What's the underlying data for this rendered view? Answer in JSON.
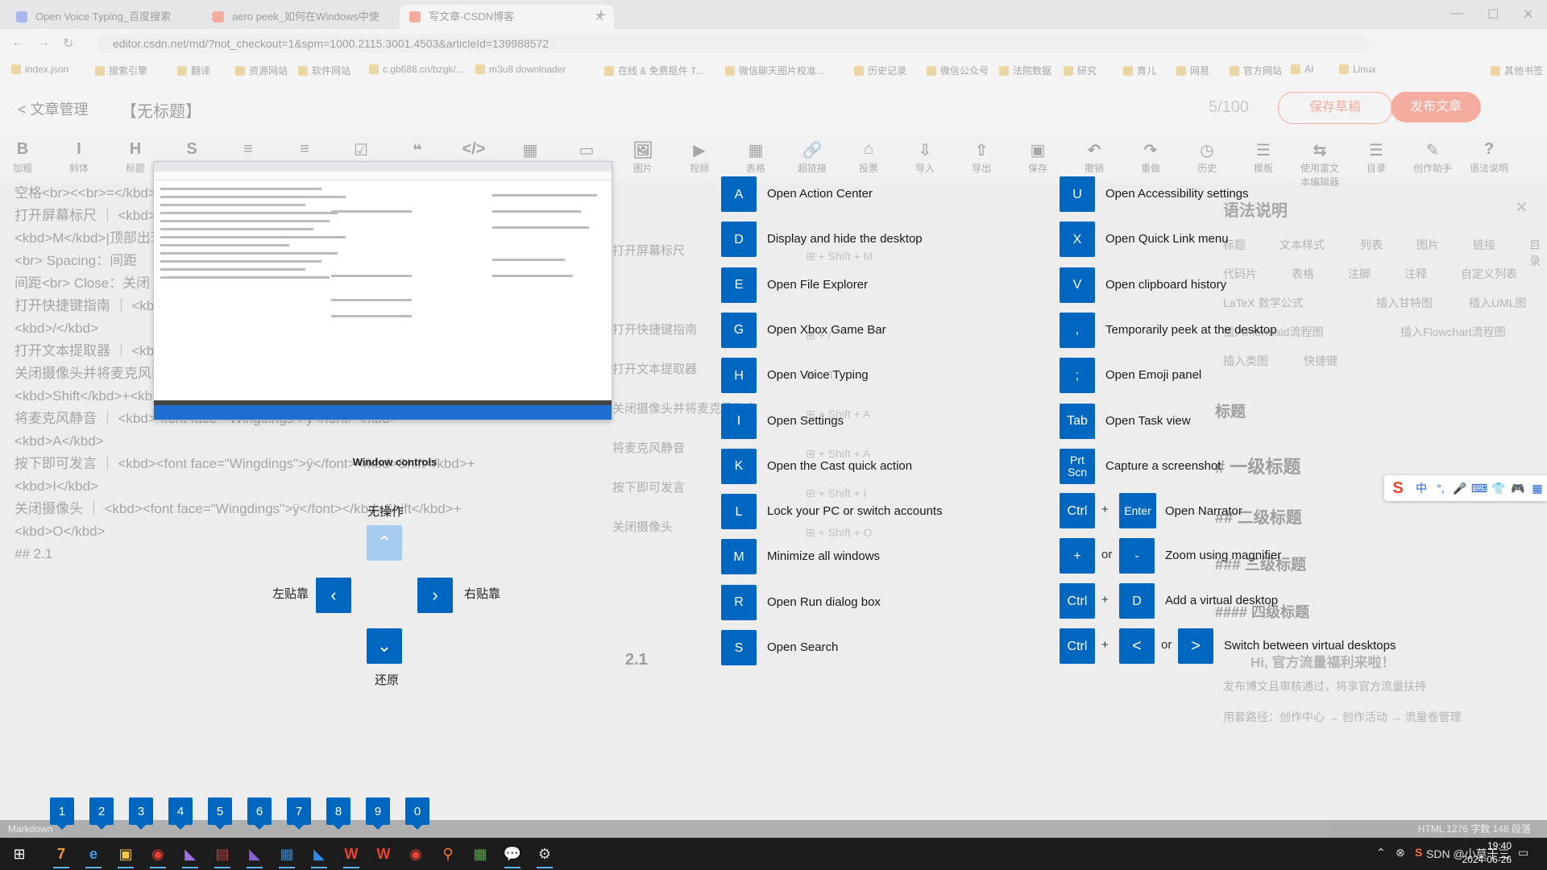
{
  "browser": {
    "tabs": [
      {
        "label": "Open Voice Typing_百度搜索",
        "color": "#4e6ef2"
      },
      {
        "label": "aero peek_如何在Windows中使",
        "color": "#fc5531"
      },
      {
        "label": "写文章-CSDN博客",
        "color": "#fc5531"
      }
    ],
    "url": "editor.csdn.net/md/?not_checkout=1&spm=1000.2115.3001.4503&articleId=139988572",
    "bookmarks": [
      "index.json",
      "搜索引擎",
      "翻译",
      "资源网站",
      "软件网站",
      "c.gb688.cn/bzgk/...",
      "m3u8 downloader",
      "在线 & 免费抠件 T...",
      "微信聊天图片校准...",
      "历史记录",
      "微信公众号",
      "法院数据",
      "研究",
      "育儿",
      "网易",
      "官方网站",
      "AI",
      "Linux",
      "其他书签"
    ]
  },
  "editor": {
    "back_label": "< 文章管理",
    "title": "【无标题】",
    "counter": "5/100",
    "save_draft": "保存草稿",
    "publish": "发布文章",
    "tools": [
      {
        "icon": "B",
        "label": "加粗"
      },
      {
        "icon": "I",
        "label": "斜体"
      },
      {
        "icon": "H",
        "label": "标题"
      },
      {
        "icon": "S",
        "label": "删除线"
      },
      {
        "icon": "≡",
        "label": "无序"
      },
      {
        "icon": "≡",
        "label": "有序"
      },
      {
        "icon": "☑",
        "label": "待办"
      },
      {
        "icon": "❝",
        "label": "引用"
      },
      {
        "icon": "</>",
        "label": "代码块"
      },
      {
        "icon": "▦",
        "label": "表格"
      },
      {
        "icon": "▭",
        "label": "目录"
      },
      {
        "icon": "🖼",
        "label": "图片"
      },
      {
        "icon": "▶",
        "label": "视频"
      },
      {
        "icon": "▦",
        "label": "表格"
      },
      {
        "icon": "🔗",
        "label": "超链接"
      },
      {
        "icon": "⌂",
        "label": "投票"
      },
      {
        "icon": "⇩",
        "label": "导入"
      },
      {
        "icon": "⇧",
        "label": "导出"
      },
      {
        "icon": "▣",
        "label": "保存"
      },
      {
        "icon": "↶",
        "label": "撤销"
      },
      {
        "icon": "↷",
        "label": "重做"
      },
      {
        "icon": "◷",
        "label": "历史"
      },
      {
        "icon": "☰",
        "label": "模板"
      },
      {
        "icon": "⇆",
        "label": "使用富文本编辑器"
      },
      {
        "icon": "☰",
        "label": "目录"
      },
      {
        "icon": "✎",
        "label": "创作助手"
      },
      {
        "icon": "?",
        "label": "语法说明"
      }
    ],
    "source_lines": [
      "空格<br><<br>=</kbd>",
      "打开屏幕标尺 ｜ <kbd><font face=\"Wingdings\">ÿ</font></kbd>Shift</kbd>+",
      "<kbd>M</kbd>|顶部出现屏幕标尺工具条",
      "<br> Spacing：间距",
      "间距<br> Close：关闭",
      "打开快捷键指南 ｜ <kbd><font face=\"Wingdings\">ÿ</font></kbd>",
      "<kbd>/</kbd>",
      "打开文本提取器 ｜ <kbd><font face=\"Wingdings\">ÿ</font></kbd>",
      "关闭摄像头并将麦克风静音 ｜ <kbd><font face=\"Wingdings\">ÿ</font></kbd>",
      "<kbd>Shift</kbd>+<kbd>",
      "将麦克风静音 ｜ <kbd><font face=\"Wingdings\">ÿ</font></kbd>",
      "<kbd>A</kbd>",
      "按下即可发言 ｜ <kbd><font face=\"Wingdings\">ÿ</font></kbd>Shift</kbd>+",
      "<kbd>I</kbd>",
      "关闭摄像头 ｜ <kbd><font face=\"Wingdings\">ÿ</font></kbd>Shift</kbd>+",
      "<kbd>O</kbd>",
      "",
      "## 2.1"
    ],
    "mid_rows": [
      {
        "label": "打开屏幕标尺",
        "keys": "⊞ + Shift + M"
      },
      {
        "label": "",
        "keys": ""
      },
      {
        "label": "打开快捷键指南",
        "keys": "⊞ + /"
      },
      {
        "label": "打开文本提取器",
        "keys": "⊞ + T"
      },
      {
        "label": "关闭摄像头并将麦克风静音",
        "keys": "⊞ + Shift + A"
      },
      {
        "label": "将麦克风静音",
        "keys": "⊞ + Shift + A"
      },
      {
        "label": "按下即可发言",
        "keys": "⊞ + Shift + I"
      },
      {
        "label": "关闭摄像头",
        "keys": "⊞ + Shift + O"
      }
    ],
    "preview_heading": "2.1",
    "right_panel": {
      "title": "语法说明",
      "tags_row1": [
        "标题",
        "文本样式",
        "列表",
        "图片",
        "链接",
        "目录"
      ],
      "tags_row2": [
        "代码片",
        "表格",
        "注脚",
        "注释",
        "自定义列表"
      ],
      "tags_row3": [
        "LaTeX 数学公式",
        "插入甘特图",
        "插入UML图"
      ],
      "tags_row4": [
        "插入mermaid流程图",
        "插入Flowchart流程图"
      ],
      "tags_row5": [
        "插入类图",
        "快捷键"
      ],
      "section": "标题",
      "h1": "# 一级标题",
      "h2": "## 二级标题",
      "h3": "### 三级标题",
      "h4": "#### 四级标题",
      "notice": "Hi, 官方流量福利来啦！",
      "notice2": "发布博文且审核通过，将享官方流量扶持",
      "notice3": "用套路径：创作中心 → 创作活动 → 流量卷管理"
    },
    "status_left": "Markdown",
    "status_right": "HTML 1276 字数 148 段落"
  },
  "overlay": {
    "window_controls_label": "Window controls",
    "no_action": "无操作",
    "snap_left": "左贴靠",
    "snap_right": "右贴靠",
    "restore": "还原",
    "left_shortcuts": [
      {
        "key": "A",
        "label": "Open Action Center"
      },
      {
        "key": "D",
        "label": "Display and hide the desktop"
      },
      {
        "key": "E",
        "label": "Open File Explorer"
      },
      {
        "key": "G",
        "label": "Open Xbox Game Bar"
      },
      {
        "key": "H",
        "label": "Open Voice Typing"
      },
      {
        "key": "I",
        "label": "Open Settings"
      },
      {
        "key": "K",
        "label": "Open the Cast quick action"
      },
      {
        "key": "L",
        "label": "Lock your PC or switch accounts"
      },
      {
        "key": "M",
        "label": "Minimize all windows"
      },
      {
        "key": "R",
        "label": "Open Run dialog box"
      },
      {
        "key": "S",
        "label": "Open Search"
      }
    ],
    "right_shortcuts": [
      {
        "key": "U",
        "label": "Open Accessibility settings"
      },
      {
        "key": "X",
        "label": "Open Quick Link menu"
      },
      {
        "key": "V",
        "label": "Open clipboard history"
      },
      {
        "key": ",",
        "label": "Temporarily peek at the desktop"
      },
      {
        "key": ";",
        "label": "Open Emoji panel"
      },
      {
        "key": "Tab",
        "label": "Open Task view"
      },
      {
        "key": "Prt Scn",
        "label": "Capture a screenshot"
      }
    ],
    "narrator": {
      "key1": "Ctrl",
      "plus": "+",
      "key2": "Enter",
      "label": "Open Narrator"
    },
    "magnifier": {
      "key1": "+",
      "or": "or",
      "key2": "-",
      "label": "Zoom using magnifier"
    },
    "virtual_desktop": {
      "key1": "Ctrl",
      "plus": "+",
      "key2": "D",
      "label": "Add a virtual desktop"
    },
    "switch_desktop": {
      "key1": "Ctrl",
      "plus": "+",
      "key2": "<",
      "or": "or",
      "key3": ">",
      "label": "Switch between virtual desktops"
    },
    "numbers": [
      "1",
      "2",
      "3",
      "4",
      "5",
      "6",
      "7",
      "8",
      "9",
      "0"
    ]
  },
  "ime": {
    "items": [
      "中",
      "°,",
      "🎤",
      "⌨",
      "👕",
      "🎮",
      "▦"
    ]
  },
  "taskbar": {
    "icons": [
      "7",
      "e",
      "▣",
      "◉",
      "◣",
      "▤",
      "◣",
      "▦",
      "◣",
      "W",
      "W",
      "◉",
      "⚲",
      "▦",
      "💬",
      "⚙"
    ],
    "tray_text": "SDN @小莫干三",
    "time": "19:40",
    "date": "2024-06-26",
    "accent": "#5fb2f2"
  },
  "colors": {
    "key_blue": "#0067c0",
    "key_disabled": "#a6cdef",
    "csdn_red": "#fc5531"
  }
}
